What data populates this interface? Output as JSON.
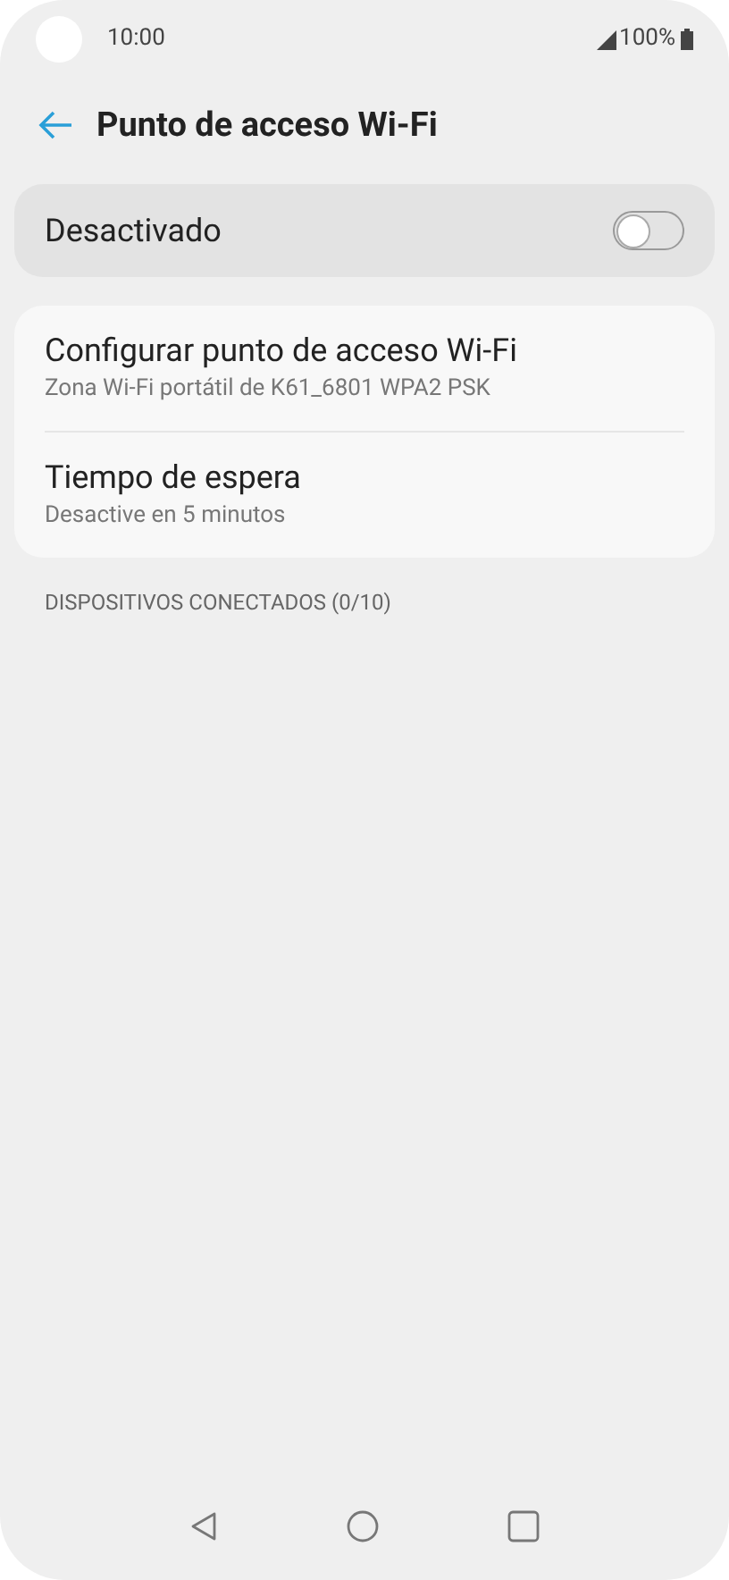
{
  "status_bar": {
    "time": "10:00",
    "battery": "100%"
  },
  "header": {
    "title": "Punto de acceso Wi-Fi"
  },
  "master_switch": {
    "label": "Desactivado",
    "on": false
  },
  "settings": [
    {
      "title": "Configurar punto de acceso Wi-Fi",
      "subtitle": "Zona Wi-Fi portátil de K61_6801 WPA2 PSK"
    },
    {
      "title": "Tiempo de espera",
      "subtitle": "Desactive en 5 minutos"
    }
  ],
  "section_header": "DISPOSITIVOS CONECTADOS (0/10)"
}
